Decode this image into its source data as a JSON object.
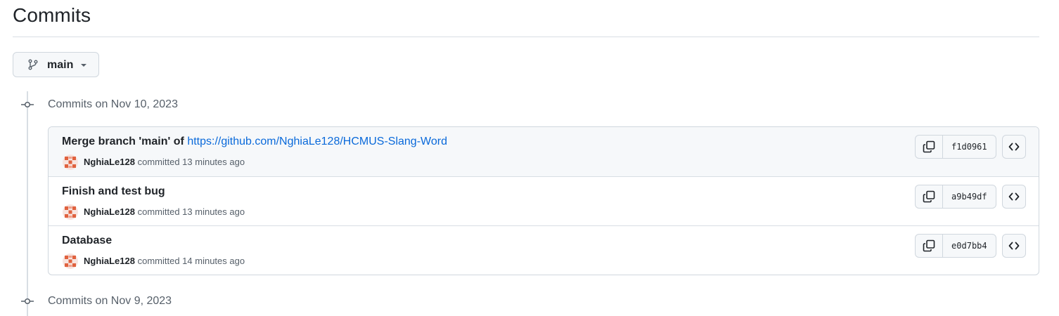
{
  "page": {
    "title": "Commits"
  },
  "branch_selector": {
    "icon": "git-branch-icon",
    "name": "main",
    "caret_icon": "triangle-down-icon"
  },
  "commit_groups": [
    {
      "heading": "Commits on Nov 10, 2023",
      "commits": [
        {
          "message_prefix": "Merge branch 'main' of ",
          "message_link": "https://github.com/NghiaLe128/HCMUS-Slang-Word",
          "author": "NghiaLe128",
          "committed_label": " committed ",
          "time": "13 minutes ago",
          "sha": "f1d0961"
        },
        {
          "message": "Finish and test bug",
          "author": "NghiaLe128",
          "committed_label": " committed ",
          "time": "13 minutes ago",
          "sha": "a9b49df"
        },
        {
          "message": "Database",
          "author": "NghiaLe128",
          "committed_label": " committed ",
          "time": "14 minutes ago",
          "sha": "e0d7bb4"
        }
      ]
    },
    {
      "heading": "Commits on Nov 9, 2023",
      "commits": []
    }
  ],
  "icons": {
    "copy": "copy-icon",
    "browse": "code-icon",
    "avatar": "identicon-avatar"
  },
  "colors": {
    "link": "#0969da",
    "muted_text": "#57606a",
    "border": "#d0d7de",
    "button_bg": "#f6f8fa",
    "avatar_accent": "#e0623f"
  }
}
